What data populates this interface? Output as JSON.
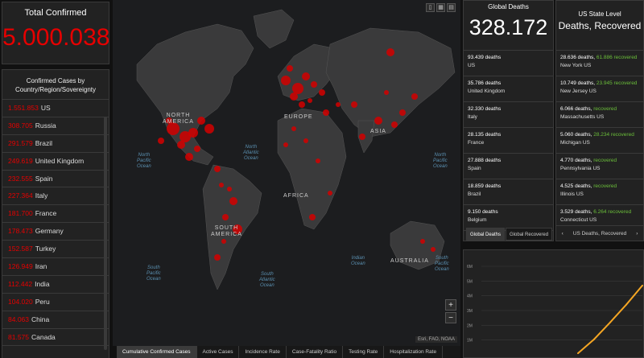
{
  "total": {
    "label": "Total Confirmed",
    "value": "5.000.038"
  },
  "countries": {
    "header": "Confirmed Cases by Country/Region/Sovereignty",
    "items": [
      {
        "count": "1.551.853",
        "name": "US"
      },
      {
        "count": "308.705",
        "name": "Russia"
      },
      {
        "count": "291.579",
        "name": "Brazil"
      },
      {
        "count": "249.619",
        "name": "United Kingdom"
      },
      {
        "count": "232.555",
        "name": "Spain"
      },
      {
        "count": "227.364",
        "name": "Italy"
      },
      {
        "count": "181.700",
        "name": "France"
      },
      {
        "count": "178.473",
        "name": "Germany"
      },
      {
        "count": "152.587",
        "name": "Turkey"
      },
      {
        "count": "126.949",
        "name": "Iran"
      },
      {
        "count": "112.442",
        "name": "India"
      },
      {
        "count": "104.020",
        "name": "Peru"
      },
      {
        "count": "84.063",
        "name": "China"
      },
      {
        "count": "81.575",
        "name": "Canada"
      },
      {
        "count": "",
        "name": ""
      }
    ]
  },
  "map": {
    "labels": {
      "north_america": "NORTH\nAMERICA",
      "europe": "EUROPE",
      "asia": "ASIA",
      "africa": "AFRICA",
      "south_america": "SOUTH\nAMERICA",
      "australia": "AUSTRALIA"
    },
    "oceans": {
      "north_pacific_w": "North\nPacific\nOcean",
      "north_atlantic": "North\nAtlantic\nOcean",
      "north_pacific_e": "North\nPacific\nOcean",
      "south_pacific": "South\nPacific\nOcean",
      "south_atlantic": "South\nAtlantic\nOcean",
      "indian": "Indian\nOcean",
      "south_pacific_e": "South\nPacific\nOcean"
    },
    "zoom_in": "+",
    "zoom_out": "−",
    "attribution": "Esri, FAO, NOAA",
    "tools": [
      "▯",
      "▦",
      "▤"
    ],
    "tabs": [
      "Cumulative Confirmed Cases",
      "Active Cases",
      "Incidence Rate",
      "Case-Fatality Ratio",
      "Testing Rate",
      "Hospitalization Rate"
    ],
    "active_tab": 0
  },
  "global_deaths": {
    "label": "Global Deaths",
    "value": "328.172",
    "items": [
      {
        "deaths": "93.439 deaths",
        "place": "US"
      },
      {
        "deaths": "35.786 deaths",
        "place": "United Kingdom"
      },
      {
        "deaths": "32.330 deaths",
        "place": "Italy"
      },
      {
        "deaths": "28.135 deaths",
        "place": "France"
      },
      {
        "deaths": "27.888 deaths",
        "place": "Spain"
      },
      {
        "deaths": "18.859 deaths",
        "place": "Brazil"
      },
      {
        "deaths": "9.150 deaths",
        "place": "Belgium"
      }
    ],
    "tabs": [
      "Global Deaths",
      "Global Recovered"
    ],
    "active_tab": 0
  },
  "us_state": {
    "label": "US State Level",
    "title": "Deaths, Recovered",
    "items": [
      {
        "deaths": "28.636 deaths,",
        "recovered": "61.886 recovered",
        "place": "New York US"
      },
      {
        "deaths": "10.749 deaths,",
        "recovered": "23.945 recovered",
        "place": "New Jersey US"
      },
      {
        "deaths": "6.066 deaths,",
        "recovered": "recovered",
        "place": "Massachusetts US"
      },
      {
        "deaths": "5.060 deaths,",
        "recovered": "28.234 recovered",
        "place": "Michigan US"
      },
      {
        "deaths": "4.770 deaths,",
        "recovered": "recovered",
        "place": "Pennsylvania US"
      },
      {
        "deaths": "4.525 deaths,",
        "recovered": "recovered",
        "place": "Illinois US"
      },
      {
        "deaths": "3.529 deaths,",
        "recovered": "6.264 recovered",
        "place": "Connecticut US"
      }
    ],
    "tab_label": "US Deaths, Recovered",
    "tab_prev": "‹",
    "tab_next": "›"
  },
  "colors": {
    "confirmed_red": "#e60000",
    "recovered_green": "#6bbf3a",
    "chart_line": "#f5a623",
    "panel_bg": "#222222"
  },
  "chart_data": {
    "type": "line",
    "y_ticks": [
      "6M",
      "5M",
      "4M",
      "3M",
      "2M",
      "1M"
    ],
    "ylim": [
      0,
      6000000
    ],
    "x": [
      0.6,
      0.7,
      0.8,
      0.9,
      1.0
    ],
    "series": [
      {
        "values": [
          100000,
          1050000,
          2200000,
          3400000,
          4700000
        ]
      }
    ]
  }
}
